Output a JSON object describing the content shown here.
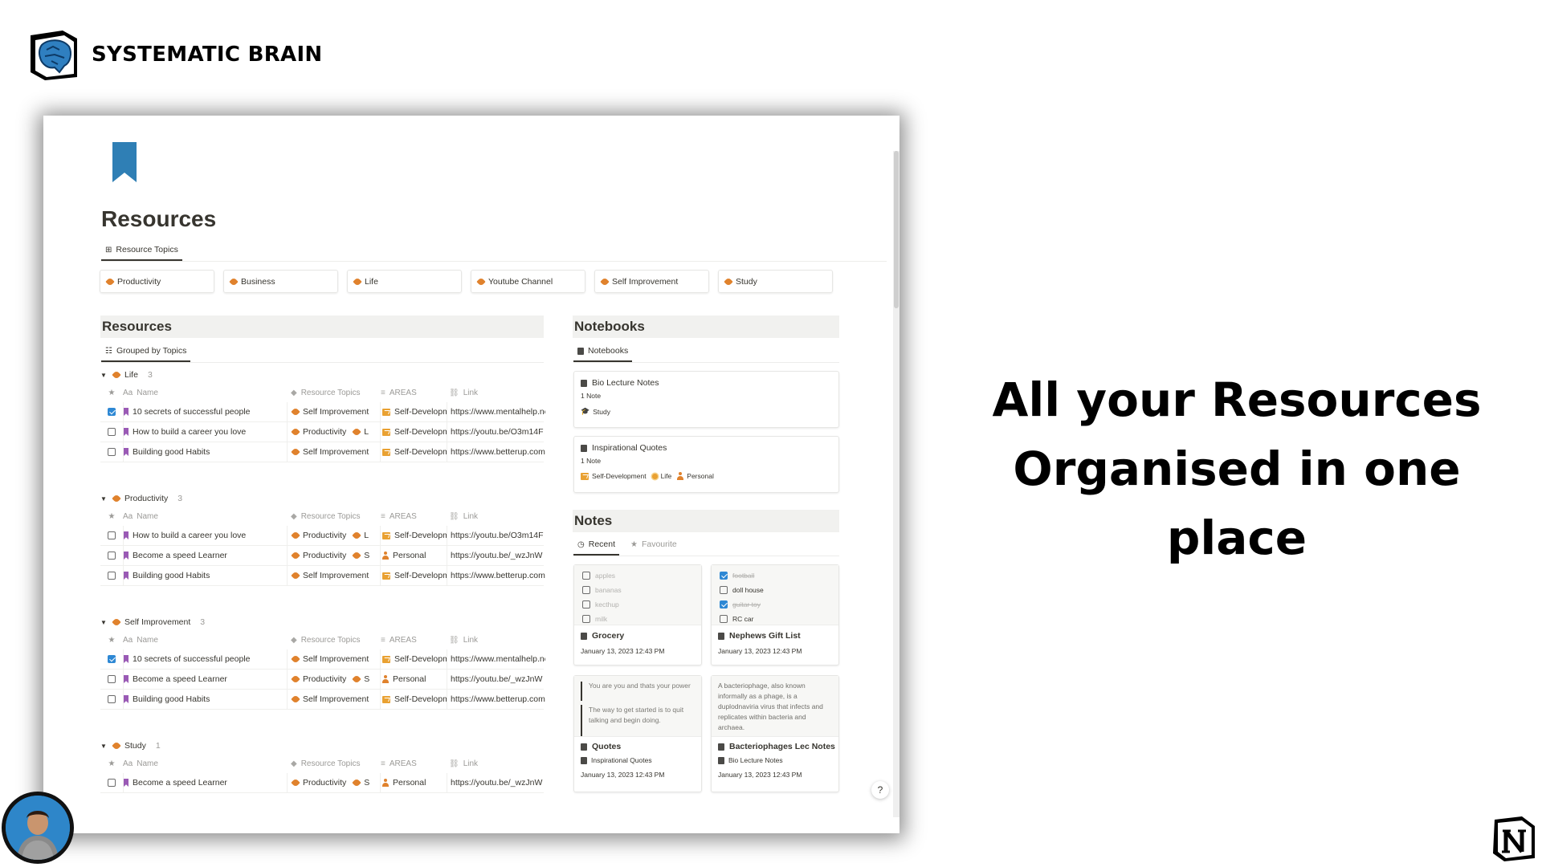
{
  "brand": {
    "name": "SYSTEMATIC BRAIN",
    "logo_icon": "brain-cube-icon"
  },
  "headline": {
    "line1": "All your Resources",
    "line2": "Organised in one place"
  },
  "page": {
    "icon": "bookmark-icon",
    "title": "Resources",
    "topics_view_tab": "Resource Topics",
    "topics": [
      "Productivity",
      "Business",
      "Life",
      "Youtube Channel",
      "Self Improvement",
      "Study"
    ]
  },
  "resources": {
    "heading": "Resources",
    "view_tab": "Grouped by Topics",
    "columns": {
      "name": "Name",
      "topics": "Resource Topics",
      "areas": "AREAS",
      "link": "Link",
      "name_prefix": "Aa"
    },
    "groups": [
      {
        "label": "Life",
        "count": "3",
        "rows": [
          {
            "checked": true,
            "name": "10 secrets of successful people",
            "topic": "Self Improvement",
            "topic_extra": "",
            "area": "Self-Development",
            "area_icon": "chart-icon",
            "link": "https://www.mentalhelp.net"
          },
          {
            "checked": false,
            "name": "How to build a career you love",
            "topic": "Productivity",
            "topic_extra": "L",
            "area": "Self-Development",
            "area_icon": "chart-icon",
            "link": "https://youtu.be/O3m14F"
          },
          {
            "checked": false,
            "name": "Building good Habits",
            "topic": "Self Improvement",
            "topic_extra": "",
            "area": "Self-Development",
            "area_icon": "chart-icon",
            "link": "https://www.betterup.com"
          }
        ]
      },
      {
        "label": "Productivity",
        "count": "3",
        "rows": [
          {
            "checked": false,
            "name": "How to build a career you love",
            "topic": "Productivity",
            "topic_extra": "L",
            "area": "Self-Development",
            "area_icon": "chart-icon",
            "link": "https://youtu.be/O3m14F"
          },
          {
            "checked": false,
            "name": "Become a speed Learner",
            "topic": "Productivity",
            "topic_extra": "S",
            "area": "Personal",
            "area_icon": "person-icon",
            "link": "https://youtu.be/_wzJnW"
          },
          {
            "checked": false,
            "name": "Building good Habits",
            "topic": "Self Improvement",
            "topic_extra": "",
            "area": "Self-Development",
            "area_icon": "chart-icon",
            "link": "https://www.betterup.com"
          }
        ]
      },
      {
        "label": "Self Improvement",
        "count": "3",
        "rows": [
          {
            "checked": true,
            "name": "10 secrets of successful people",
            "topic": "Self Improvement",
            "topic_extra": "",
            "area": "Self-Development",
            "area_icon": "chart-icon",
            "link": "https://www.mentalhelp.net"
          },
          {
            "checked": false,
            "name": "Become a speed Learner",
            "topic": "Productivity",
            "topic_extra": "S",
            "area": "Personal",
            "area_icon": "person-icon",
            "link": "https://youtu.be/_wzJnW"
          },
          {
            "checked": false,
            "name": "Building good Habits",
            "topic": "Self Improvement",
            "topic_extra": "",
            "area": "Self-Development",
            "area_icon": "chart-icon",
            "link": "https://www.betterup.com"
          }
        ]
      },
      {
        "label": "Study",
        "count": "1",
        "rows": [
          {
            "checked": false,
            "name": "Become a speed Learner",
            "topic": "Productivity",
            "topic_extra": "S",
            "area": "Personal",
            "area_icon": "person-icon",
            "link": "https://youtu.be/_wzJnW"
          }
        ]
      }
    ]
  },
  "notebooks": {
    "heading": "Notebooks",
    "view_tab": "Notebooks",
    "items": [
      {
        "title": "Bio Lecture Notes",
        "count": "1 Note",
        "tags": [
          {
            "icon": "hat-icon",
            "label": "Study"
          }
        ]
      },
      {
        "title": "Inspirational Quotes",
        "count": "1 Note",
        "tags": [
          {
            "icon": "chart-icon",
            "label": "Self-Development"
          },
          {
            "icon": "sun-icon",
            "label": "Life"
          },
          {
            "icon": "person-icon",
            "label": "Personal"
          }
        ]
      }
    ]
  },
  "notes": {
    "heading": "Notes",
    "tabs": {
      "recent": "Recent",
      "favourite": "Favourite"
    },
    "cards": [
      {
        "title": "Grocery",
        "date": "January 13, 2023 12:43 PM",
        "todos": [
          {
            "text": "apples",
            "checked": false
          },
          {
            "text": "bananas",
            "checked": false
          },
          {
            "text": "kecthup",
            "checked": false
          },
          {
            "text": "milk",
            "checked": false
          }
        ]
      },
      {
        "title": "Nephews Gift List",
        "date": "January 13, 2023 12:43 PM",
        "todos": [
          {
            "text": "football",
            "checked": true
          },
          {
            "text": "doll house",
            "checked": false
          },
          {
            "text": "guitar toy",
            "checked": true
          },
          {
            "text": "RC car",
            "checked": false
          }
        ]
      },
      {
        "title": "Quotes",
        "relation": "Inspirational Quotes",
        "date": "January 13, 2023 12:43 PM",
        "quote1": "You are you and thats your power",
        "quote2": "The way to get started is to quit talking and begin doing."
      },
      {
        "title": "Bacteriophages Lec Notes",
        "relation": "Bio Lecture Notes",
        "date": "January 13, 2023 12:43 PM",
        "preview": "A bacteriophage, also known informally as a phage, is a duplodnaviria virus that infects and replicates within bacteria and archaea."
      }
    ]
  },
  "help_label": "?",
  "colors": {
    "accent": "#2e88d4",
    "tag": "#e0822d",
    "bookmark": "#2f7fb5",
    "resource_bookmark": "#9a5ab5",
    "section_bg": "#f1f1ef"
  }
}
